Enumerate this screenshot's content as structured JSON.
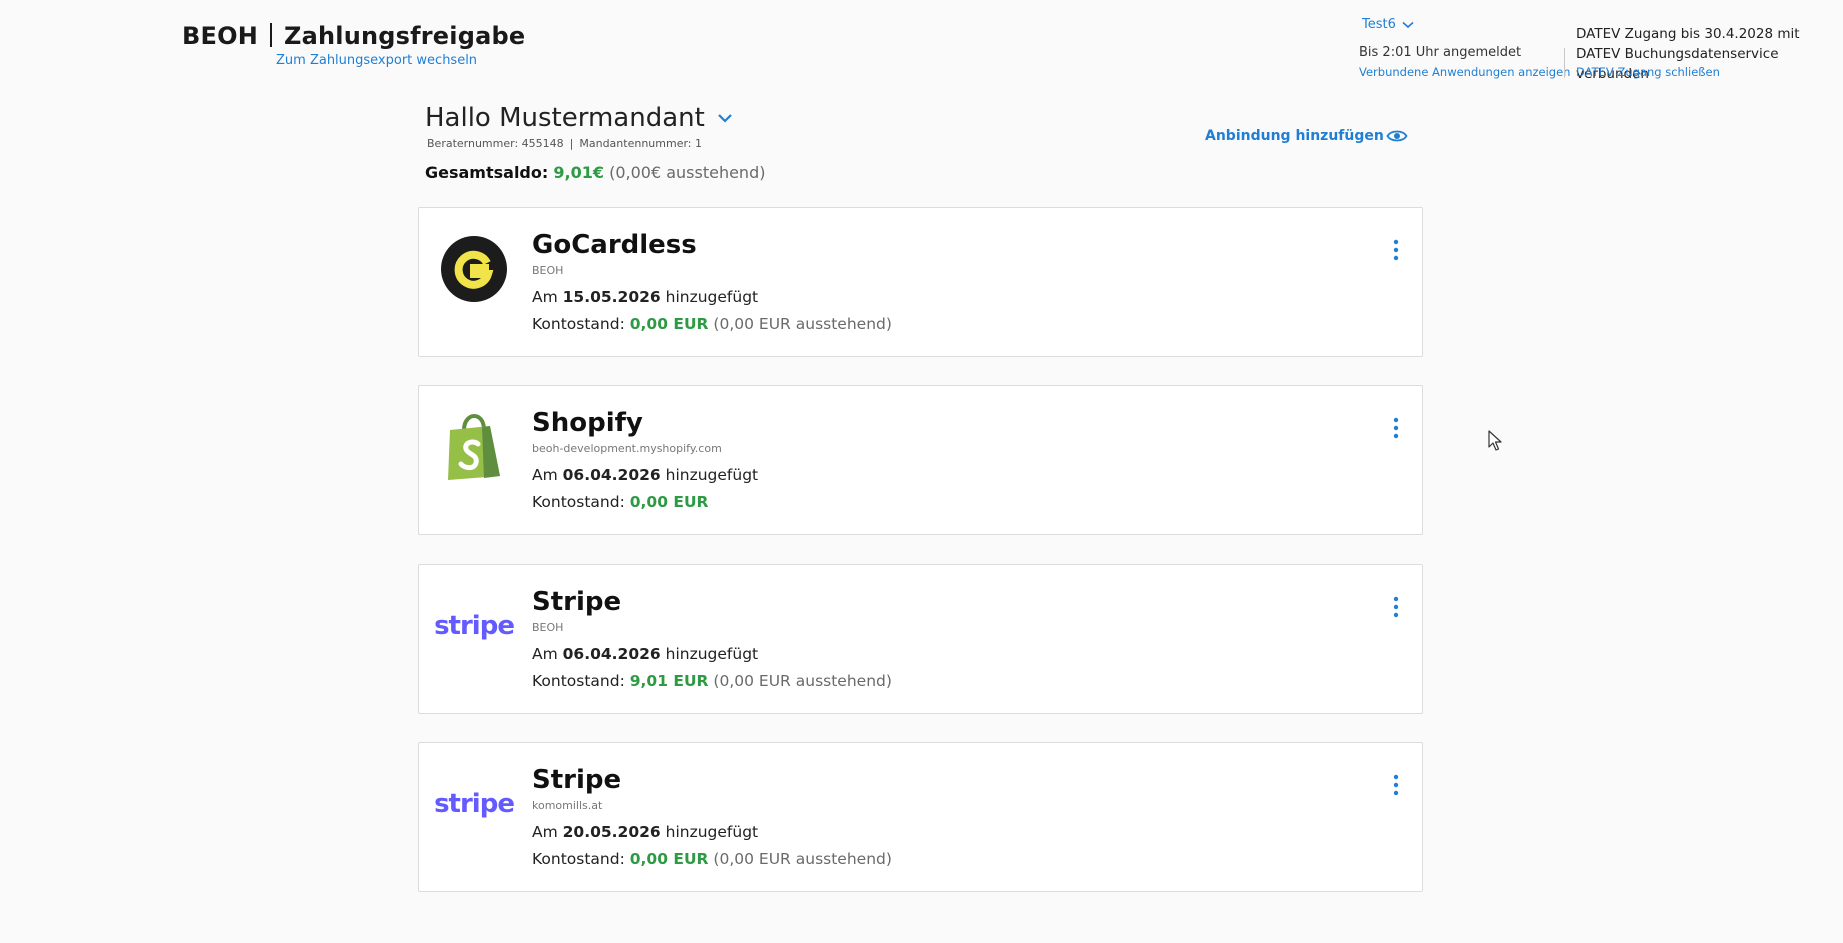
{
  "header": {
    "brand": "BEOH",
    "product": "Zahlungsfreigabe",
    "switch_link": "Zum Zahlungsexport wechseln",
    "user": "Test6",
    "session": "Bis 2:01 Uhr angemeldet",
    "apps_link": "Verbundene Anwendungen anzeigen",
    "datev_text": "DATEV Zugang bis 30.4.2028 mit DATEV Buchungsdatenservice verbunden",
    "datev_link": "DATEV Zugang schließen"
  },
  "greeting": {
    "text": "Hallo Mustermandant",
    "berater_label": "Beraternummer: 455148",
    "mandant_label": "Mandantennummer: 1",
    "separator": "|",
    "total_label": "Gesamtsaldo:",
    "total_value": "9,01€",
    "total_pending": "(0,00€ ausstehend)"
  },
  "actions": {
    "add_connection": "Anbindung hinzufügen"
  },
  "labels": {
    "added_prefix": "Am",
    "added_suffix": "hinzugefügt",
    "balance_prefix": "Kontostand:"
  },
  "connections": [
    {
      "title": "GoCardless",
      "subtitle": "BEOH",
      "date": "15.05.2026",
      "balance": "0,00 EUR",
      "pending": "(0,00 EUR ausstehend)",
      "logo": "gocardless-logo"
    },
    {
      "title": "Shopify",
      "subtitle": "beoh-development.myshopify.com",
      "date": "06.04.2026",
      "balance": "0,00 EUR",
      "pending": "",
      "logo": "shopify-logo"
    },
    {
      "title": "Stripe",
      "subtitle": "BEOH",
      "date": "06.04.2026",
      "balance": "9,01 EUR",
      "pending": "(0,00 EUR ausstehend)",
      "logo": "stripe-logo",
      "logo_text": "stripe"
    },
    {
      "title": "Stripe",
      "subtitle": "komomills.at",
      "date": "20.05.2026",
      "balance": "0,00 EUR",
      "pending": "(0,00 EUR ausstehend)",
      "logo": "stripe-logo",
      "logo_text": "stripe"
    }
  ],
  "colors": {
    "accent": "#1f7fd4",
    "positive": "#2e9b44",
    "stripe": "#635bff",
    "shopify": "#95bf47"
  },
  "icons": [
    "chevron-down-icon",
    "eye-icon",
    "kebab-menu-icon",
    "mouse-cursor-icon"
  ]
}
